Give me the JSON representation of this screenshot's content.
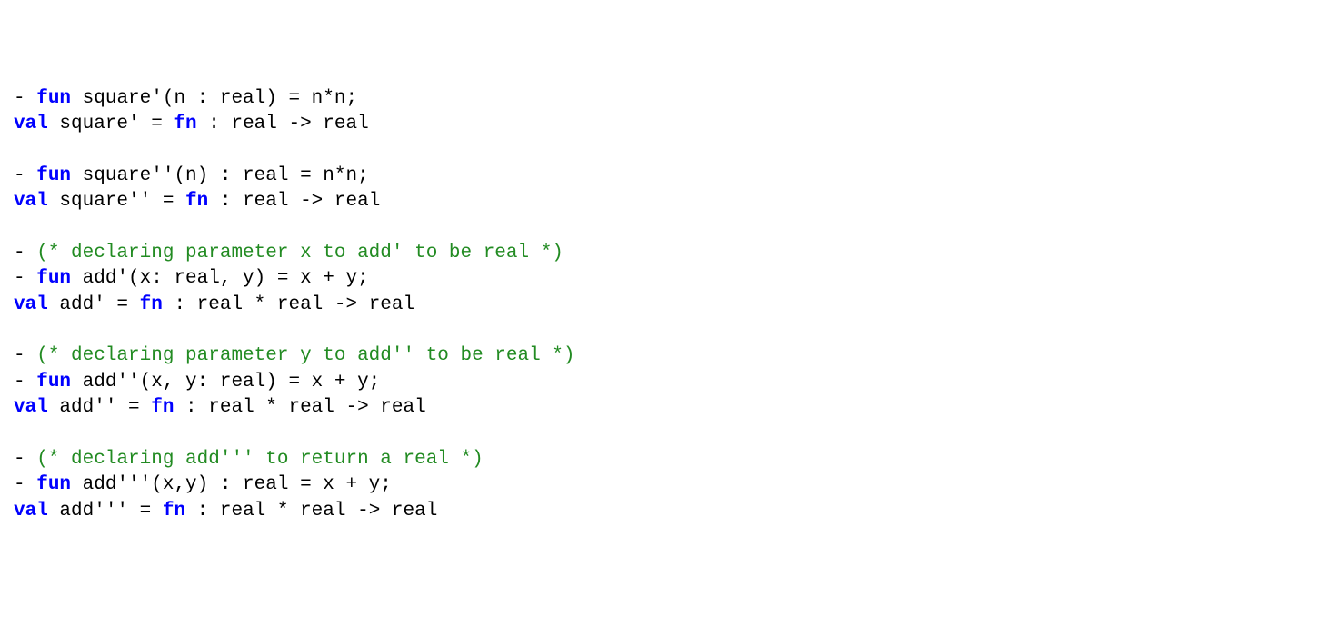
{
  "code": {
    "l1": {
      "p1": "- ",
      "kw": "fun",
      "p2": " square'(n : real) = n*n;"
    },
    "l2": {
      "kw1": "val",
      "p1": " square' = ",
      "kw2": "fn",
      "p2": " : real -> real"
    },
    "l3": "",
    "l4": {
      "p1": "- ",
      "kw": "fun",
      "p2": " square''(n) : real = n*n;"
    },
    "l5": {
      "kw1": "val",
      "p1": " square'' = ",
      "kw2": "fn",
      "p2": " : real -> real"
    },
    "l6": "",
    "l7": {
      "p1": "- ",
      "cm": "(* declaring parameter x to add' to be real *)"
    },
    "l8": {
      "p1": "- ",
      "kw": "fun",
      "p2": " add'(x: real, y) = x + y;"
    },
    "l9": {
      "kw1": "val",
      "p1": " add' = ",
      "kw2": "fn",
      "p2": " : real * real -> real"
    },
    "l10": "",
    "l11": {
      "p1": "- ",
      "cm": "(* declaring parameter y to add'' to be real *)"
    },
    "l12": {
      "p1": "- ",
      "kw": "fun",
      "p2": " add''(x, y: real) = x + y;"
    },
    "l13": {
      "kw1": "val",
      "p1": " add'' = ",
      "kw2": "fn",
      "p2": " : real * real -> real"
    },
    "l14": "",
    "l15": {
      "p1": "- ",
      "cm": "(* declaring add''' to return a real *)"
    },
    "l16": {
      "p1": "- ",
      "kw": "fun",
      "p2": " add'''(x,y) : real = x + y;"
    },
    "l17": {
      "kw1": "val",
      "p1": " add''' = ",
      "kw2": "fn",
      "p2": " : real * real -> real"
    }
  }
}
